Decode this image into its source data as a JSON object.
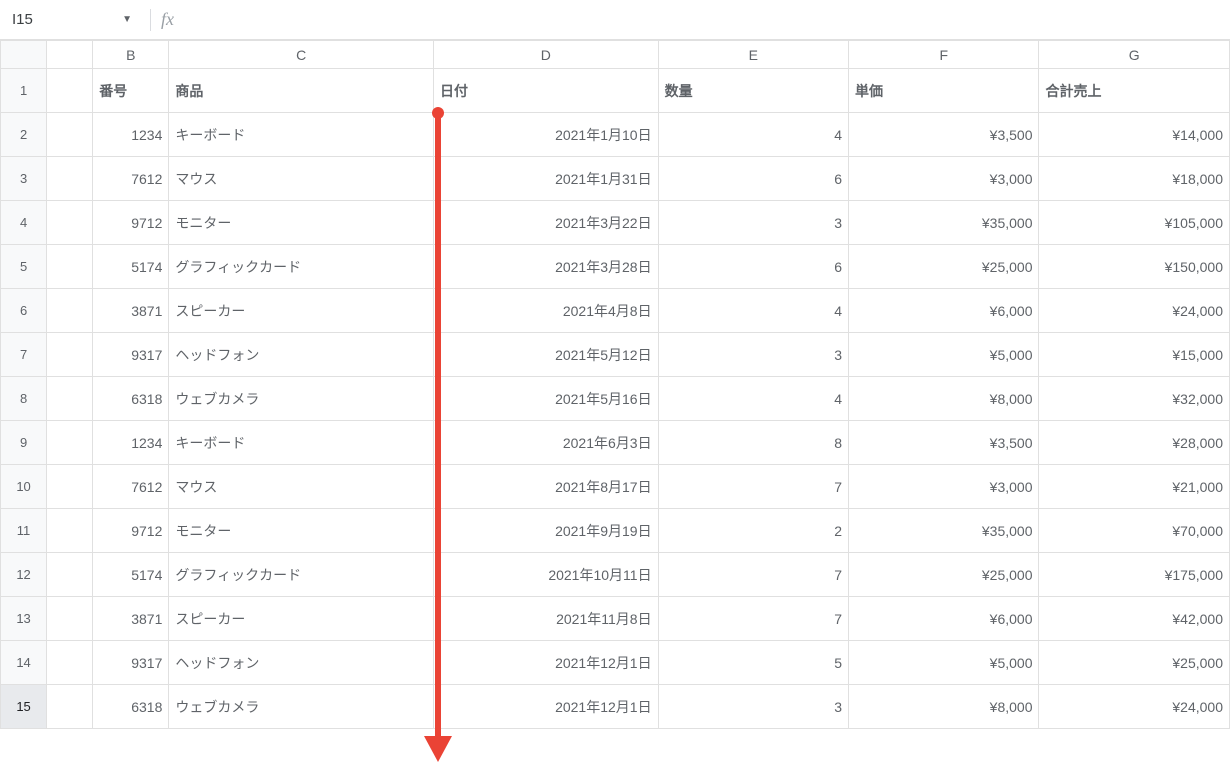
{
  "namebox": {
    "value": "I15"
  },
  "formula": {
    "value": ""
  },
  "columns": [
    "B",
    "C",
    "D",
    "E",
    "F",
    "G"
  ],
  "headers": {
    "B": "番号",
    "C": "商品",
    "D": "日付",
    "E": "数量",
    "F": "単価",
    "G": "合計売上"
  },
  "rows": [
    {
      "n": "1234",
      "p": "キーボード",
      "d": "2021年1月10日",
      "q": "4",
      "u": "¥3,500",
      "t": "¥14,000"
    },
    {
      "n": "7612",
      "p": "マウス",
      "d": "2021年1月31日",
      "q": "6",
      "u": "¥3,000",
      "t": "¥18,000"
    },
    {
      "n": "9712",
      "p": "モニター",
      "d": "2021年3月22日",
      "q": "3",
      "u": "¥35,000",
      "t": "¥105,000"
    },
    {
      "n": "5174",
      "p": "グラフィックカード",
      "d": "2021年3月28日",
      "q": "6",
      "u": "¥25,000",
      "t": "¥150,000"
    },
    {
      "n": "3871",
      "p": "スピーカー",
      "d": "2021年4月8日",
      "q": "4",
      "u": "¥6,000",
      "t": "¥24,000"
    },
    {
      "n": "9317",
      "p": "ヘッドフォン",
      "d": "2021年5月12日",
      "q": "3",
      "u": "¥5,000",
      "t": "¥15,000"
    },
    {
      "n": "6318",
      "p": "ウェブカメラ",
      "d": "2021年5月16日",
      "q": "4",
      "u": "¥8,000",
      "t": "¥32,000"
    },
    {
      "n": "1234",
      "p": "キーボード",
      "d": "2021年6月3日",
      "q": "8",
      "u": "¥3,500",
      "t": "¥28,000"
    },
    {
      "n": "7612",
      "p": "マウス",
      "d": "2021年8月17日",
      "q": "7",
      "u": "¥3,000",
      "t": "¥21,000"
    },
    {
      "n": "9712",
      "p": "モニター",
      "d": "2021年9月19日",
      "q": "2",
      "u": "¥35,000",
      "t": "¥70,000"
    },
    {
      "n": "5174",
      "p": "グラフィックカード",
      "d": "2021年10月11日",
      "q": "7",
      "u": "¥25,000",
      "t": "¥175,000"
    },
    {
      "n": "3871",
      "p": "スピーカー",
      "d": "2021年11月8日",
      "q": "7",
      "u": "¥6,000",
      "t": "¥42,000"
    },
    {
      "n": "9317",
      "p": "ヘッドフォン",
      "d": "2021年12月1日",
      "q": "5",
      "u": "¥5,000",
      "t": "¥25,000"
    },
    {
      "n": "6318",
      "p": "ウェブカメラ",
      "d": "2021年12月1日",
      "q": "3",
      "u": "¥8,000",
      "t": "¥24,000"
    }
  ],
  "rowNumbers": [
    "1",
    "2",
    "3",
    "4",
    "5",
    "6",
    "7",
    "8",
    "9",
    "10",
    "11",
    "12",
    "13",
    "14",
    "15"
  ],
  "selectedRow": "15"
}
